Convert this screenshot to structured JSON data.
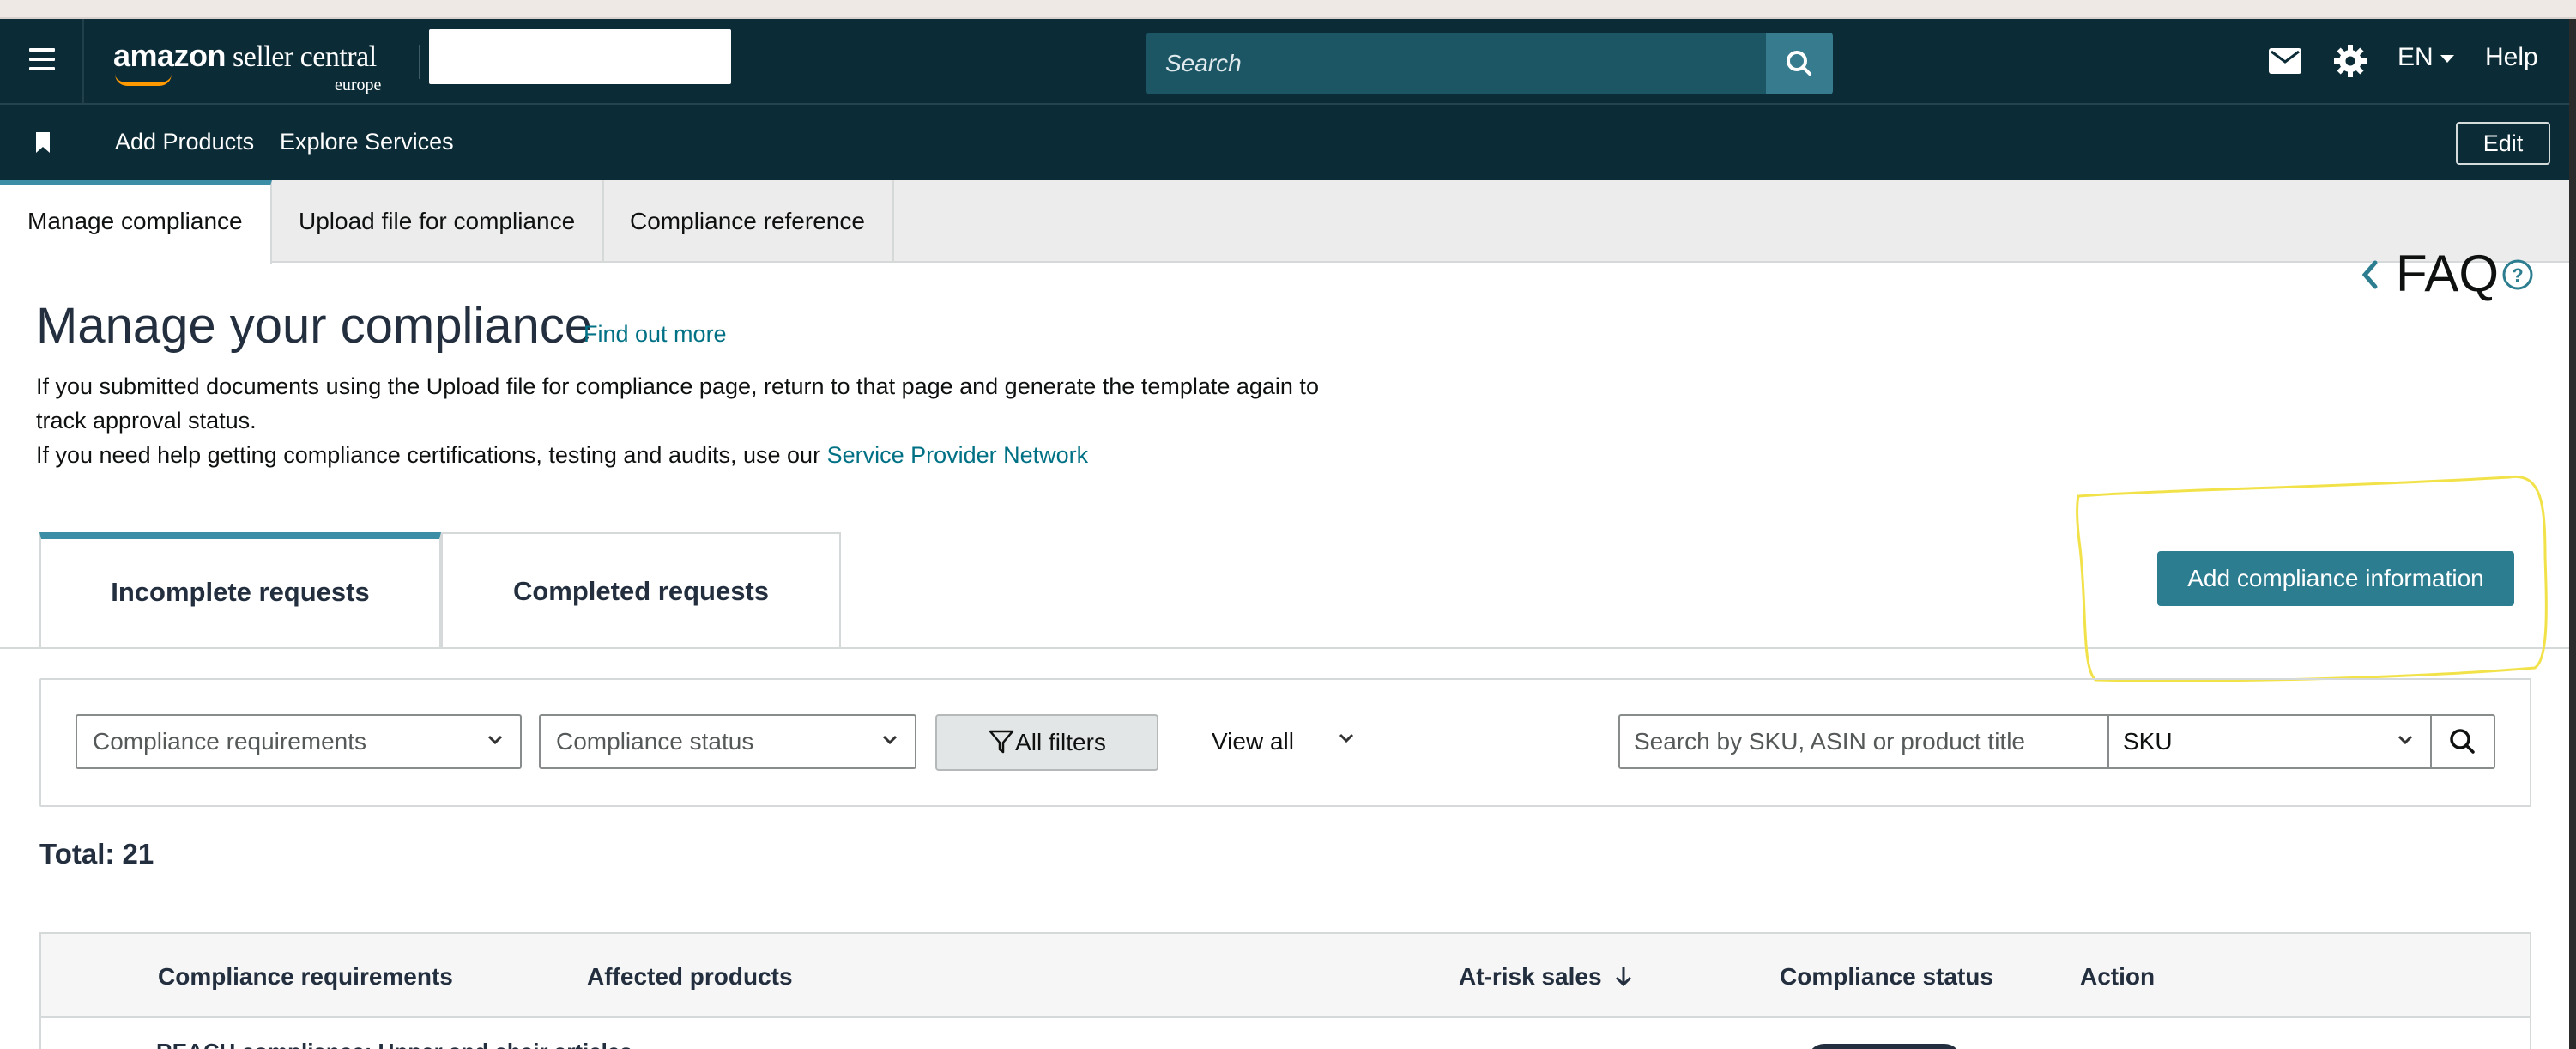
{
  "header": {
    "logo_main_bold": "amazon",
    "logo_main_light": " seller central",
    "logo_sub": "europe",
    "search_placeholder": "Search",
    "language": "EN",
    "help": "Help"
  },
  "subnav": {
    "links": [
      "Add Products",
      "Explore Services"
    ],
    "edit": "Edit"
  },
  "tabs": [
    {
      "label": "Manage compliance",
      "active": true
    },
    {
      "label": "Upload file for compliance",
      "active": false
    },
    {
      "label": "Compliance reference",
      "active": false
    }
  ],
  "faq": {
    "label": "FAQ"
  },
  "page": {
    "title": "Manage your compliance",
    "find_out_more": "Find out more",
    "intro_line1": "If you submitted documents using the Upload file for compliance page, return to that page and generate the template again to track approval status.",
    "intro_line2_prefix": "If you need help getting compliance certifications, testing and audits, use our ",
    "intro_line2_link": "Service Provider Network"
  },
  "request_tabs": [
    {
      "label": "Incomplete requests",
      "active": true
    },
    {
      "label": "Completed requests",
      "active": false
    }
  ],
  "add_button": "Add compliance information",
  "filters": {
    "compliance_requirements": "Compliance requirements",
    "compliance_status": "Compliance status",
    "all_filters": "All filters",
    "view_all": "View all",
    "search_placeholder": "Search by SKU, ASIN or product title",
    "search_type": "SKU"
  },
  "total": "Total: 21",
  "table": {
    "columns": [
      "Compliance requirements",
      "Affected products",
      "At-risk sales",
      "Compliance status",
      "Action"
    ],
    "first_row_partial": "REACH compliance: Upper and chair articles"
  },
  "colors": {
    "nav_bg": "#0b2b36",
    "accent": "#3b8ea5",
    "link": "#007185",
    "primary_button": "#2b7d8f",
    "annotation": "#f2e24a"
  }
}
